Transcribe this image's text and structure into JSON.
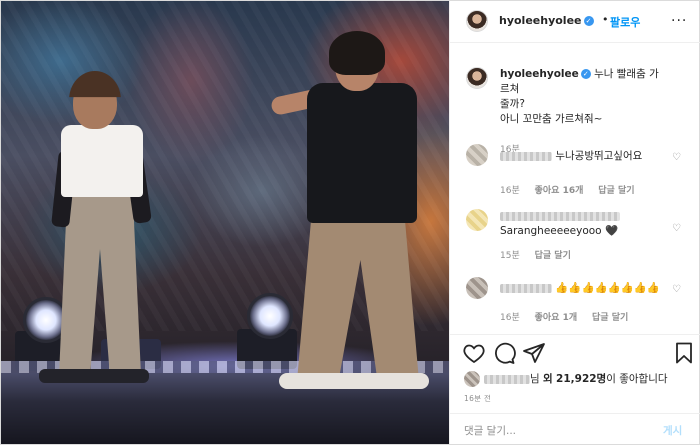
{
  "post": {
    "username": "hyoleehyolee",
    "verified_icon": "verified-badge-icon",
    "separator": "•",
    "follow_label": "팔로우",
    "more_label": "..."
  },
  "caption": {
    "username": "hyoleehyolee",
    "text_line1": "누나 빨래춤 가르쳐",
    "text_line2": "줄까?",
    "text_line3": "아니 꼬만춤 가르쳐줘~",
    "time": "16분"
  },
  "comments": [
    {
      "text": "누나공방뛰고싶어요",
      "time": "16분",
      "likes": "좋아요 16개",
      "reply": "답글 달기"
    },
    {
      "text": "Sarangheeeeeyooo 🖤",
      "time": "15분",
      "reply": "답글 달기"
    },
    {
      "text": "👍👍👍👍👍👍👍👍",
      "time": "16분",
      "likes": "좋아요 1개",
      "reply": "답글 달기"
    }
  ],
  "likes_line": {
    "suffix_name": "님",
    "and_others": "외",
    "count": "21,922명",
    "tail": "이 좋아합니다"
  },
  "timestamp": "16분 전",
  "comment_input": {
    "placeholder": "댓글 달기...",
    "post_label": "게시"
  },
  "colors": {
    "accent": "#0095f6",
    "verified": "#3897f0",
    "muted_text": "#8e8e8e",
    "border": "#dbdbdb"
  },
  "icons": [
    "heart-icon",
    "comment-icon",
    "share-icon",
    "bookmark-icon"
  ]
}
